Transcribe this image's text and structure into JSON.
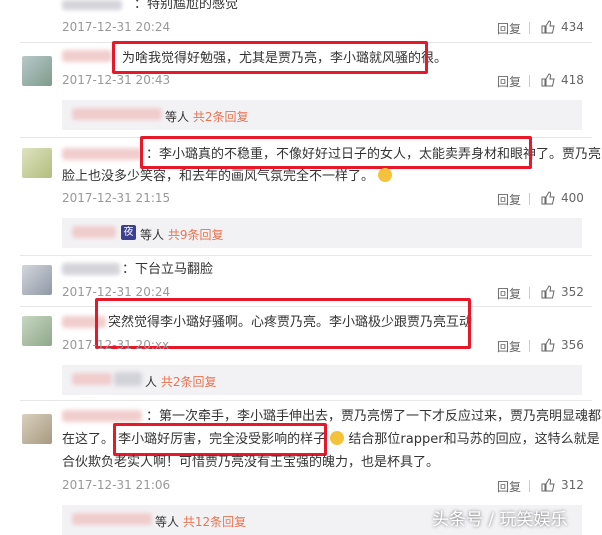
{
  "comments": [
    {
      "text": "：特别尴尬的感觉",
      "time": "2017-12-31 20:24",
      "reply": "回复",
      "likes": "434"
    },
    {
      "text": "为啥我觉得好勉强，尤其是贾乃亮，李小璐就风骚的很。",
      "time": "2017-12-31 20:43",
      "reply": "回复",
      "likes": "418",
      "sub": {
        "suffix": "等人",
        "count_text": "共2条回复"
      }
    },
    {
      "text": "：李小璐真的不稳重，不像好好过日子的女人，太能卖弄身材和眼神了。贾乃亮",
      "text2": "脸上也没多少笑容，和去年的画风气氛完全不一样了。",
      "time": "2017-12-31 21:15",
      "reply": "回复",
      "likes": "400",
      "sub": {
        "tag": "夜",
        "suffix": "等人",
        "count_text": "共9条回复"
      }
    },
    {
      "text": "：下台立马翻脸",
      "time": "2017-12-31 20:24",
      "reply": "回复",
      "likes": "352"
    },
    {
      "text": "突然觉得李小璐好骚啊。心疼贾乃亮。李小璐极少跟贾乃亮互动",
      "time": "2017-12-31 20:xx",
      "reply": "回复",
      "likes": "356",
      "sub": {
        "suffix": "人",
        "count_text": "共2条回复"
      }
    },
    {
      "text": "：第一次牵手，李小璐手伸出去，贾乃亮愣了一下才反应过来，贾乃亮明显魂都不",
      "text2": "在这了。  李小璐好厉害，完全没受影响的样子",
      "text2b": "结合那位rapper和马苏的回应，这特么就是",
      "text3": "合伙欺负老实人啊！可惜贾乃亮没有王宝强的魄力，也是杯具了。",
      "time": "2017-12-31 21:06",
      "reply": "回复",
      "likes": "312",
      "sub": {
        "suffix": "等人",
        "count_text": "共12条回复"
      }
    }
  ],
  "watermark": "头条号 / 玩笑娱乐",
  "colors": {
    "highlight": "#e8182b",
    "link": "#eb7350"
  }
}
